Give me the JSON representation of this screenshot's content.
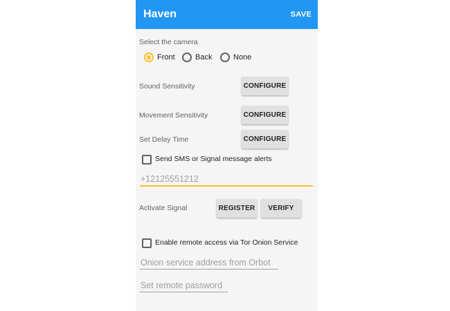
{
  "app": {
    "title": "Haven",
    "save_label": "SAVE"
  },
  "colors": {
    "appbar": "#2196f3",
    "accent": "#fbc02d",
    "background": "#f5f5f5"
  },
  "camera": {
    "label": "Select the camera",
    "options": [
      {
        "label": "Front",
        "selected": true
      },
      {
        "label": "Back",
        "selected": false
      },
      {
        "label": "None",
        "selected": false
      }
    ]
  },
  "settings": {
    "sound": {
      "label": "Sound Sensitivity",
      "button": "CONFIGURE"
    },
    "movement": {
      "label": "Movement Sensitivity",
      "button": "CONFIGURE"
    },
    "delay": {
      "label": "Set Delay Time",
      "button": "CONFIGURE"
    }
  },
  "sms": {
    "checkbox_label": "Send SMS or Signal message alerts",
    "checked": false,
    "phone_placeholder": "+12125551212"
  },
  "signal": {
    "label": "Activate Signal",
    "register_label": "REGISTER",
    "verify_label": "VERIFY"
  },
  "remote": {
    "checkbox_label": "Enable remote access via Tor Onion Service",
    "checked": false,
    "onion_placeholder": "Onion service address from Orbot",
    "password_placeholder": "Set remote password"
  }
}
